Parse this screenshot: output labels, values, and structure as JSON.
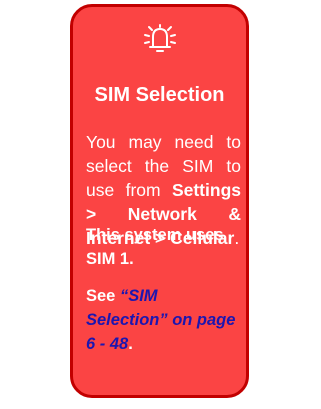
{
  "card": {
    "icon": "alarm-bell-icon",
    "title": "SIM Selection",
    "para1": {
      "t1": "You may need to select the SIM to use from ",
      "path": "Settings > Network & Internet > Cellular",
      "t2": "."
    },
    "para2": "This system uses SIM 1.",
    "para3": {
      "see": "See ",
      "link": "“SIM Selection” on page 6 - 48",
      "end": "."
    }
  },
  "colors": {
    "card_fill": "#fb4444",
    "card_border": "#c20000",
    "text": "#ffffff",
    "link": "#1c16b0"
  }
}
